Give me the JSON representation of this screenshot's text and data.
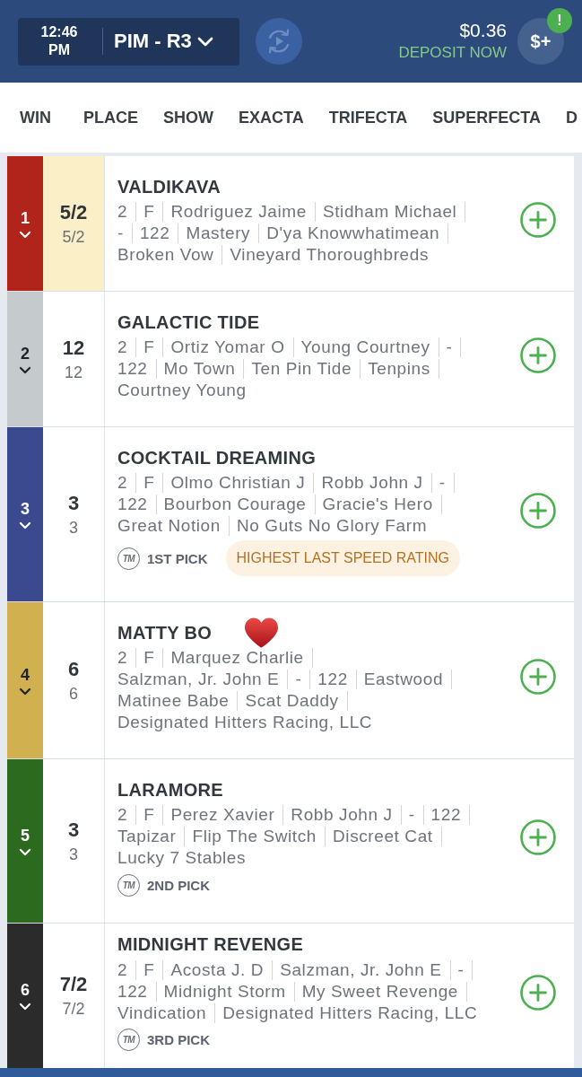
{
  "header": {
    "time": "12:46 PM",
    "race": "PIM - R3",
    "balance": "$0.36",
    "deposit_link": "DEPOSIT NOW",
    "wallet_button": {
      "label": "$+",
      "alert": "!"
    }
  },
  "tabs": [
    {
      "label": "WIN"
    },
    {
      "label": "PLACE"
    },
    {
      "label": "SHOW"
    },
    {
      "label": "EXACTA"
    },
    {
      "label": "TRIFECTA"
    },
    {
      "label": "SUPERFECTA"
    },
    {
      "label": "D"
    }
  ],
  "runners": [
    {
      "number": "1",
      "color": "#b0241c",
      "odds": "5/2",
      "morning_line": "5/2",
      "odds_highlighted": true,
      "name": "VALDIKAVA",
      "favorite": false,
      "details": [
        "2",
        "F",
        "Rodriguez Jaime",
        "Stidham Michael",
        "-",
        "122",
        "Mastery",
        "D'ya Knowwhatimean",
        "Broken Vow",
        "Vineyard Thoroughbreds"
      ]
    },
    {
      "number": "2",
      "color": "#c5cacd",
      "odds": "12",
      "morning_line": "12",
      "odds_highlighted": false,
      "name": "GALACTIC TIDE",
      "favorite": false,
      "details": [
        "2",
        "F",
        "Ortiz Yomar O",
        "Young Courtney",
        "-",
        "122",
        "Mo Town",
        "Ten Pin Tide",
        "Tenpins",
        "Courtney Young"
      ]
    },
    {
      "number": "3",
      "color": "#3b4a8e",
      "odds": "3",
      "morning_line": "3",
      "odds_highlighted": false,
      "name": "COCKTAIL DREAMING",
      "favorite": false,
      "details": [
        "2",
        "F",
        "Olmo Christian J",
        "Robb John J",
        "-",
        "122",
        "Bourbon Courage",
        "Gracie's Hero",
        "Great Notion",
        "No Guts No Glory Farm"
      ],
      "pick": {
        "logo": "TM",
        "label": "1ST PICK"
      },
      "badge": "HIGHEST LAST SPEED RATING"
    },
    {
      "number": "4",
      "color": "#d1b14f",
      "odds": "6",
      "morning_line": "6",
      "odds_highlighted": false,
      "name": "MATTY BO",
      "favorite": true,
      "details": [
        "2",
        "F",
        "Marquez Charlie",
        "Salzman, Jr. John E",
        "-",
        "122",
        "Eastwood",
        "Matinee Babe",
        "Scat Daddy",
        "Designated Hitters Racing, LLC"
      ]
    },
    {
      "number": "5",
      "color": "#2c6a1f",
      "odds": "3",
      "morning_line": "3",
      "odds_highlighted": false,
      "name": "LARAMORE",
      "favorite": false,
      "details": [
        "2",
        "F",
        "Perez Xavier",
        "Robb John J",
        "-",
        "122",
        "Tapizar",
        "Flip The Switch",
        "Discreet Cat",
        "Lucky 7 Stables"
      ],
      "pick": {
        "logo": "TM",
        "label": "2ND PICK"
      }
    },
    {
      "number": "6",
      "color": "#2b2b2b",
      "odds": "7/2",
      "morning_line": "7/2",
      "odds_highlighted": false,
      "name": "MIDNIGHT REVENGE",
      "favorite": false,
      "details": [
        "2",
        "F",
        "Acosta J. D",
        "Salzman, Jr. John E",
        "-",
        "122",
        "Midnight Storm",
        "My Sweet Revenge",
        "Vindication",
        "Designated Hitters Racing, LLC"
      ],
      "pick": {
        "logo": "TM",
        "label": "3RD PICK"
      }
    }
  ]
}
